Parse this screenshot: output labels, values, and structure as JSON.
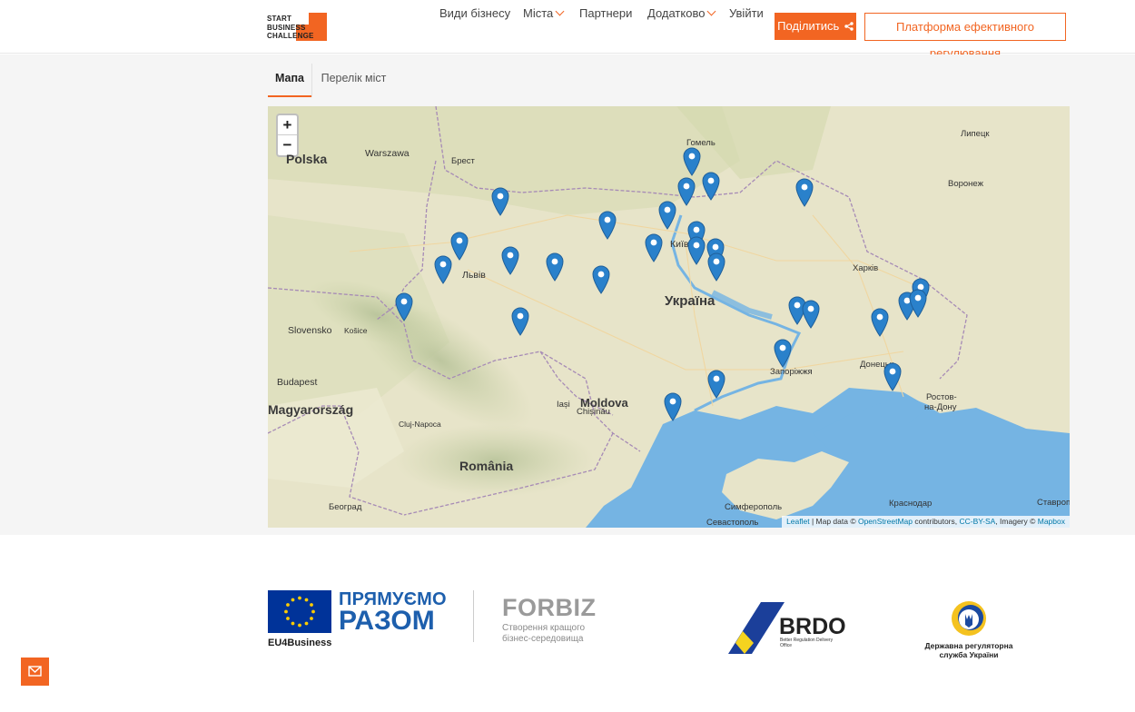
{
  "logo": {
    "line1": "START",
    "line2": "BUSINESS",
    "line3": "CHALLENGE"
  },
  "nav": {
    "items": [
      {
        "label": "Види бізнесу",
        "dropdown": false
      },
      {
        "label": "Міста",
        "dropdown": true
      },
      {
        "label": "Партнери",
        "dropdown": false
      },
      {
        "label": "Додатково",
        "dropdown": true
      },
      {
        "label": "Увійти",
        "dropdown": false
      }
    ],
    "share_label": "Поділитись",
    "share_icon": "share-icon",
    "platform_label": "Платформа ефективного регулювання"
  },
  "tabs": {
    "map": "Мапа",
    "list": "Перелік міст"
  },
  "map": {
    "zoom_in": "+",
    "zoom_out": "−",
    "labels": {
      "polska": "Polska",
      "warszawa": "Warszawa",
      "brest": "Брест",
      "gomel": "Гомель",
      "lipetsk": "Липецк",
      "voronezh": "Воронеж",
      "kyiv": "Київ",
      "lviv": "Львів",
      "ukraina": "Україна",
      "kharkiv": "Харків",
      "slovensko": "Slovensko",
      "kosice": "Košice",
      "budapest": "Budapest",
      "magyar": "Magyarország",
      "zaporizhzhia": "Запоріжжя",
      "donetsk": "Донецьк",
      "rostov1": "Ростов-",
      "rostov2": "на-Дону",
      "iasi": "Iași",
      "moldova": "Moldova",
      "chisinau": "Chișinău",
      "cluj": "Cluj-Napoca",
      "romania": "România",
      "beograd": "Београд",
      "simferopol": "Симферополь",
      "sevastopol": "Севастополь",
      "krasnodar": "Краснодар",
      "stavrop": "Ставроп"
    },
    "attribution": {
      "leaflet": "Leaflet",
      "sep": " | Map data © ",
      "osm": "OpenStreetMap",
      "contrib": " contributors, ",
      "ccbysa": "CC-BY-SA",
      "imagery": ", Imagery © ",
      "mapbox": "Mapbox"
    },
    "marker_color": "#2a81cb",
    "marker_icon": "map-pin-icon"
  },
  "footer": {
    "eu_line1": "ПРЯМУЄМО",
    "eu_line2": "РАЗОМ",
    "eu_sub": "EU4Business",
    "forbiz": "FORBIZ",
    "forbiz_sub": "Створення кращого бізнес-середовища",
    "brdo": "BRDO",
    "brdo_sub": "Better Regulation Delivery Office",
    "drs": "Державна регуляторна служба України",
    "mail_icon": "envelope-icon"
  },
  "colors": {
    "accent": "#f26522",
    "eu_blue": "#003399",
    "water": "#75b4e3"
  }
}
